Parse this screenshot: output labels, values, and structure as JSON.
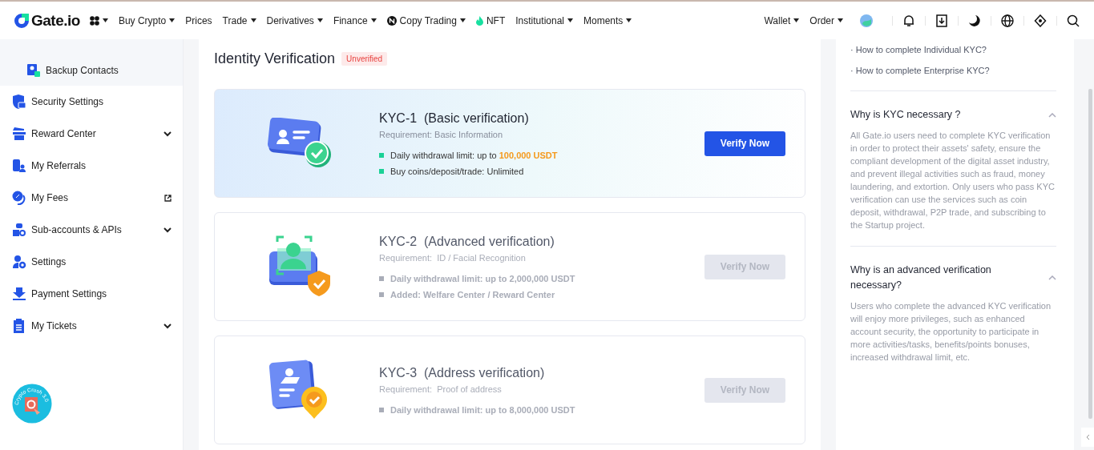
{
  "header": {
    "logo": "Gate.io",
    "nav": [
      {
        "label": "Buy Crypto",
        "dropdown": true
      },
      {
        "label": "Prices",
        "dropdown": false
      },
      {
        "label": "Trade",
        "dropdown": true
      },
      {
        "label": "Derivatives",
        "dropdown": true
      },
      {
        "label": "Finance",
        "dropdown": true
      },
      {
        "label": "Copy Trading",
        "dropdown": true,
        "kind": "copy"
      },
      {
        "label": "NFT",
        "dropdown": false,
        "kind": "nft"
      },
      {
        "label": "Institutional",
        "dropdown": true
      },
      {
        "label": "Moments",
        "dropdown": true
      }
    ],
    "right_nav": [
      {
        "label": "Wallet",
        "dropdown": true
      },
      {
        "label": "Order",
        "dropdown": true
      }
    ]
  },
  "sidebar": {
    "items": [
      {
        "label": "Backup Contacts",
        "sub": true,
        "expandable": false,
        "external": false
      },
      {
        "label": "Security Settings",
        "sub": false,
        "expandable": false,
        "external": false
      },
      {
        "label": "Reward Center",
        "sub": false,
        "expandable": true,
        "external": false
      },
      {
        "label": "My Referrals",
        "sub": false,
        "expandable": false,
        "external": false
      },
      {
        "label": "My Fees",
        "sub": false,
        "expandable": false,
        "external": true
      },
      {
        "label": "Sub-accounts & APIs",
        "sub": false,
        "expandable": true,
        "external": false
      },
      {
        "label": "Settings",
        "sub": false,
        "expandable": false,
        "external": false
      },
      {
        "label": "Payment Settings",
        "sub": false,
        "expandable": false,
        "external": false
      },
      {
        "label": "My Tickets",
        "sub": false,
        "expandable": true,
        "external": false
      }
    ],
    "promo_badge": "Crypto Crush 3.0"
  },
  "main": {
    "title": "Identity Verification",
    "status": "Unverified",
    "cards": [
      {
        "title": "KYC-1  (Basic verification)",
        "requirement": "Requirement: Basic Information",
        "disabled": false,
        "button": "Verify Now",
        "bullets": [
          {
            "text": "Daily withdrawal limit: up to ",
            "highlight": "100,000 USDT"
          },
          {
            "text": "Buy coins/deposit/trade: Unlimited"
          }
        ]
      },
      {
        "title": "KYC-2  (Advanced verification)",
        "requirement": "Requirement:  ID / Facial Recognition",
        "disabled": true,
        "button": "Verify Now",
        "bullets": [
          {
            "text": "Daily withdrawal limit: up to 2,000,000 USDT"
          },
          {
            "text": "Added: Welfare Center / Reward Center"
          }
        ]
      },
      {
        "title": "KYC-3  (Address verification)",
        "requirement": "Requirement:  Proof of address",
        "disabled": true,
        "button": "Verify Now",
        "bullets": [
          {
            "text": "Daily withdrawal limit: up to 8,000,000 USDT"
          }
        ]
      }
    ]
  },
  "help": {
    "links": [
      "· How to complete Individual KYC?",
      "· How to complete Enterprise KYC?"
    ],
    "faqs": [
      {
        "question": "Why is KYC necessary ?",
        "expanded": true,
        "answer": "All Gate.io users need to complete KYC verification in order to protect their assets' safety, ensure the compliant development of the digital asset industry, and prevent illegal activities such as fraud, money laundering, and extortion. Only users who pass KYC verification can use the services such as coin deposit, withdrawal, P2P trade, and subscribing to the Startup project."
      },
      {
        "question": "Why is an advanced verification necessary?",
        "expanded": true,
        "answer": "Users who complete the advanced KYC verification will enjoy more privileges, such as enhanced account security, the opportunity to participate in more activities/tasks, benefits/points bonuses, increased withdrawal limit, etc."
      }
    ]
  }
}
